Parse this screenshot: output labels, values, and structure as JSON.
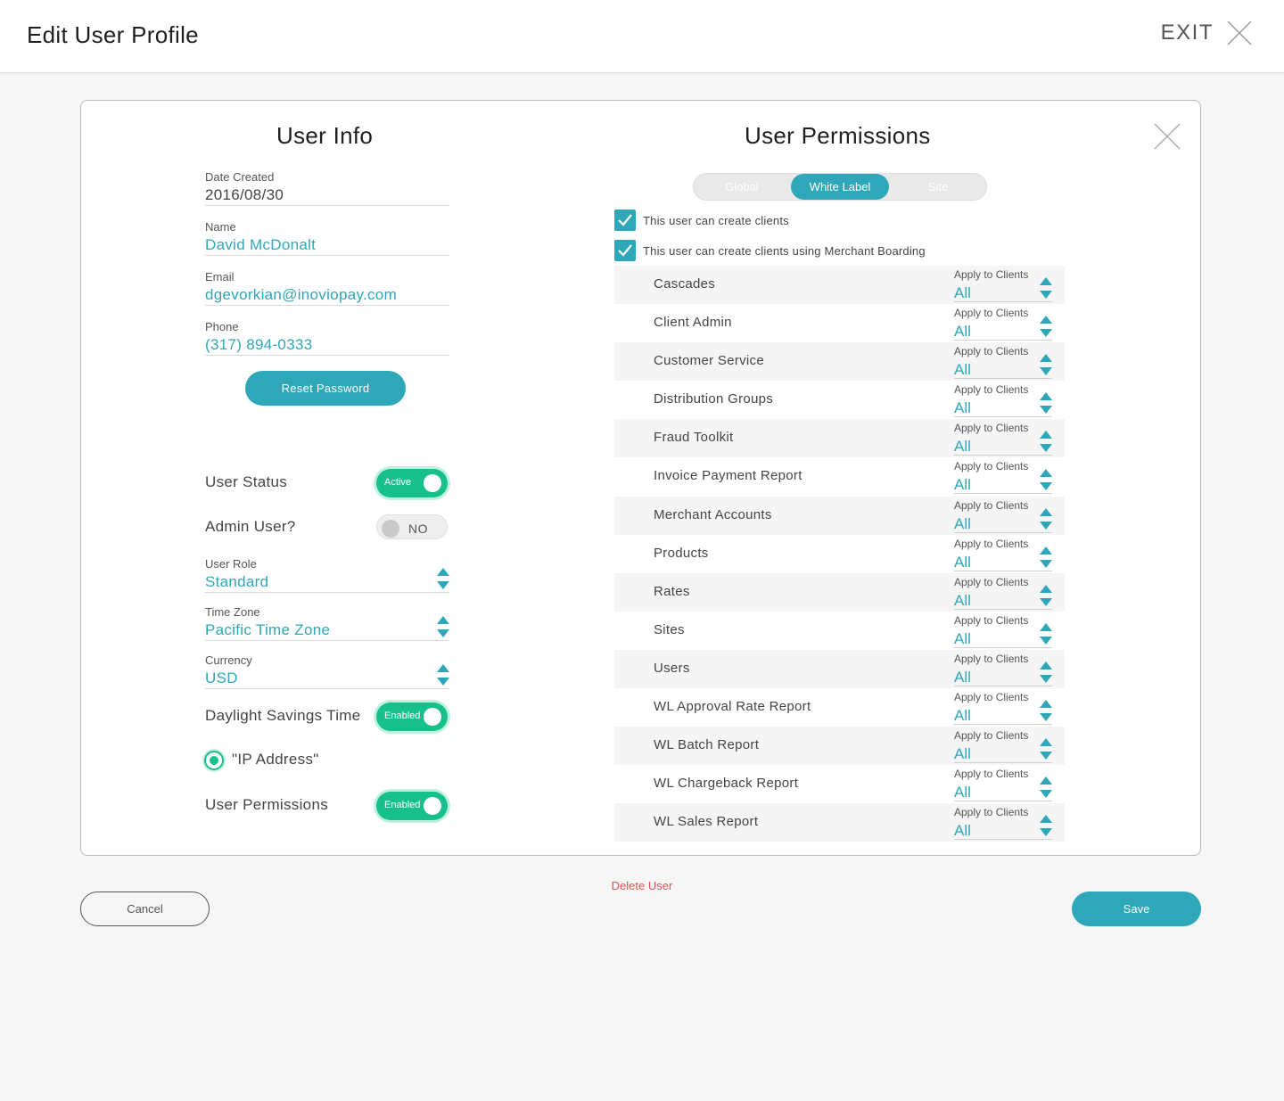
{
  "header": {
    "title": "Edit User Profile",
    "exit_label": "EXIT"
  },
  "user_info": {
    "title": "User Info",
    "date_created": {
      "label": "Date Created",
      "value": "2016/08/30"
    },
    "name": {
      "label": "Name",
      "value": "David McDonalt"
    },
    "email": {
      "label": "Email",
      "value": "dgevorkian@inoviopay.com"
    },
    "phone": {
      "label": "Phone",
      "value": "(317) 894-0333"
    },
    "reset_password_label": "Reset Password",
    "user_status": {
      "label": "User Status",
      "toggle": "Active",
      "on": true
    },
    "admin_user": {
      "label": "Admin User?",
      "toggle": "NO",
      "on": false
    },
    "user_role": {
      "label": "User Role",
      "value": "Standard"
    },
    "time_zone": {
      "label": "Time Zone",
      "value": "Pacific Time Zone"
    },
    "currency": {
      "label": "Currency",
      "value": "USD"
    },
    "daylight_savings": {
      "label": "Daylight Savings Time",
      "toggle": "Enabled",
      "on": true
    },
    "ip_address": {
      "label": "\"IP Address\"",
      "selected": true
    },
    "user_permissions": {
      "label": "User Permissions",
      "toggle": "Enabled",
      "on": true
    }
  },
  "permissions": {
    "title": "User Permissions",
    "tabs": [
      {
        "label": "Global",
        "active": false
      },
      {
        "label": "White Label",
        "active": true
      },
      {
        "label": "Site",
        "active": false
      }
    ],
    "checks": [
      {
        "label": "This user can create clients",
        "checked": true
      },
      {
        "label": "This user can create clients using Merchant Boarding",
        "checked": true
      }
    ],
    "select_label": "Apply to Clients",
    "items": [
      {
        "name": "Cascades",
        "value": "All"
      },
      {
        "name": "Client Admin",
        "value": "All"
      },
      {
        "name": "Customer Service",
        "value": "All"
      },
      {
        "name": "Distribution Groups",
        "value": "All"
      },
      {
        "name": "Fraud Toolkit",
        "value": "All"
      },
      {
        "name": "Invoice Payment Report",
        "value": "All"
      },
      {
        "name": "Merchant Accounts",
        "value": "All"
      },
      {
        "name": "Products",
        "value": "All"
      },
      {
        "name": "Rates",
        "value": "All"
      },
      {
        "name": "Sites",
        "value": "All"
      },
      {
        "name": "Users",
        "value": "All"
      },
      {
        "name": "WL Approval Rate Report",
        "value": "All"
      },
      {
        "name": "WL Batch Report",
        "value": "All"
      },
      {
        "name": "WL Chargeback Report",
        "value": "All"
      },
      {
        "name": "WL Sales Report",
        "value": "All"
      }
    ]
  },
  "footer": {
    "cancel_label": "Cancel",
    "delete_label": "Delete User",
    "save_label": "Save"
  },
  "colors": {
    "accent": "#2ea7b8",
    "toggle_on": "#17c08b",
    "danger": "#e2534d"
  }
}
